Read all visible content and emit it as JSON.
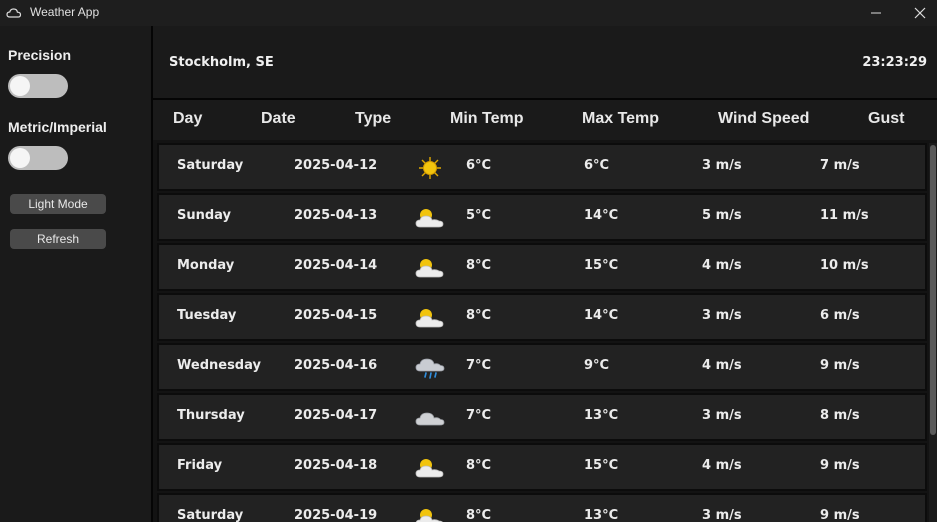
{
  "window": {
    "title": "Weather App",
    "minimize_glyph": "—",
    "close_glyph": "✕"
  },
  "sidebar": {
    "precision_label": "Precision",
    "precision_on": false,
    "units_label": "Metric/Imperial",
    "units_on": false,
    "light_mode_label": "Light Mode",
    "refresh_label": "Refresh"
  },
  "header": {
    "location": "Stockholm, SE",
    "time": "23:23:29"
  },
  "columns": [
    "Day",
    "Date",
    "Type",
    "Min Temp",
    "Max Temp",
    "Wind Speed",
    "Gust"
  ],
  "forecast": [
    {
      "day": "Saturday",
      "date": "2025-04-12",
      "type": "sun-icon",
      "min": "6°C",
      "max": "6°C",
      "wind": "3 m/s",
      "gust": "7 m/s"
    },
    {
      "day": "Sunday",
      "date": "2025-04-13",
      "type": "partly-cloudy-icon",
      "min": "5°C",
      "max": "14°C",
      "wind": "5 m/s",
      "gust": "11 m/s"
    },
    {
      "day": "Monday",
      "date": "2025-04-14",
      "type": "partly-cloudy-icon",
      "min": "8°C",
      "max": "15°C",
      "wind": "4 m/s",
      "gust": "10 m/s"
    },
    {
      "day": "Tuesday",
      "date": "2025-04-15",
      "type": "partly-cloudy-icon",
      "min": "8°C",
      "max": "14°C",
      "wind": "3 m/s",
      "gust": "6 m/s"
    },
    {
      "day": "Wednesday",
      "date": "2025-04-16",
      "type": "rain-icon",
      "min": "7°C",
      "max": "9°C",
      "wind": "4 m/s",
      "gust": "9 m/s"
    },
    {
      "day": "Thursday",
      "date": "2025-04-17",
      "type": "cloud-icon",
      "min": "7°C",
      "max": "13°C",
      "wind": "3 m/s",
      "gust": "8 m/s"
    },
    {
      "day": "Friday",
      "date": "2025-04-18",
      "type": "partly-cloudy-icon",
      "min": "8°C",
      "max": "15°C",
      "wind": "4 m/s",
      "gust": "9 m/s"
    },
    {
      "day": "Saturday",
      "date": "2025-04-19",
      "type": "partly-cloudy-icon",
      "min": "8°C",
      "max": "13°C",
      "wind": "3 m/s",
      "gust": "9 m/s"
    }
  ],
  "colors": {
    "background": "#1a1a1a",
    "row": "#222222",
    "sun": "#f2c40d",
    "cloud": "#e6e6e6"
  }
}
